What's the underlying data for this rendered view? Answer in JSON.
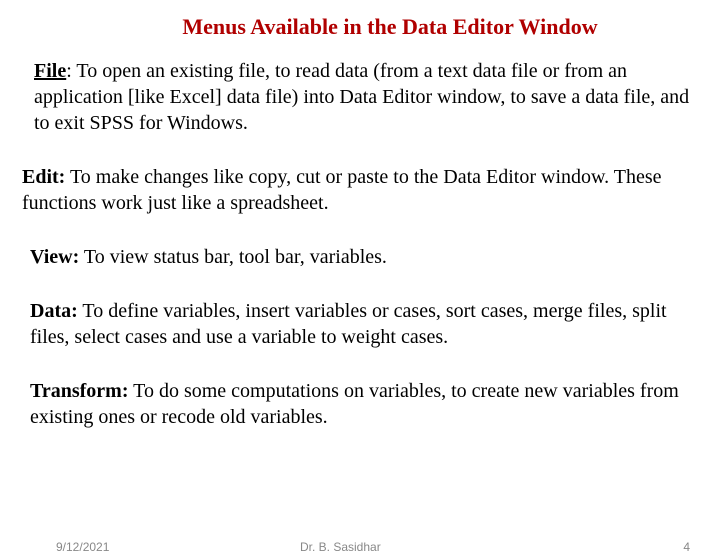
{
  "title": "Menus Available in the Data Editor Window",
  "sections": {
    "file": {
      "name": "File",
      "desc": ": To open an existing file, to read data (from a text data file or from an application [like Excel] data file) into Data Editor window, to save a data file, and to exit SPSS for Windows."
    },
    "edit": {
      "name": "Edit:",
      "desc": " To make changes like copy, cut or paste to the Data Editor window.  These functions work just like a spreadsheet."
    },
    "view": {
      "name": "View:",
      "desc": " To view status bar, tool bar, variables."
    },
    "data": {
      "name": "Data:",
      "desc": " To define variables, insert variables or cases, sort cases, merge files, split files, select cases and use a variable to weight cases."
    },
    "transform": {
      "name": "Transform:",
      "desc": " To do some computations on variables, to create new variables from existing ones or recode old variables."
    }
  },
  "footer": {
    "date": "9/12/2021",
    "author": "Dr. B. Sasidhar",
    "page": "4"
  }
}
